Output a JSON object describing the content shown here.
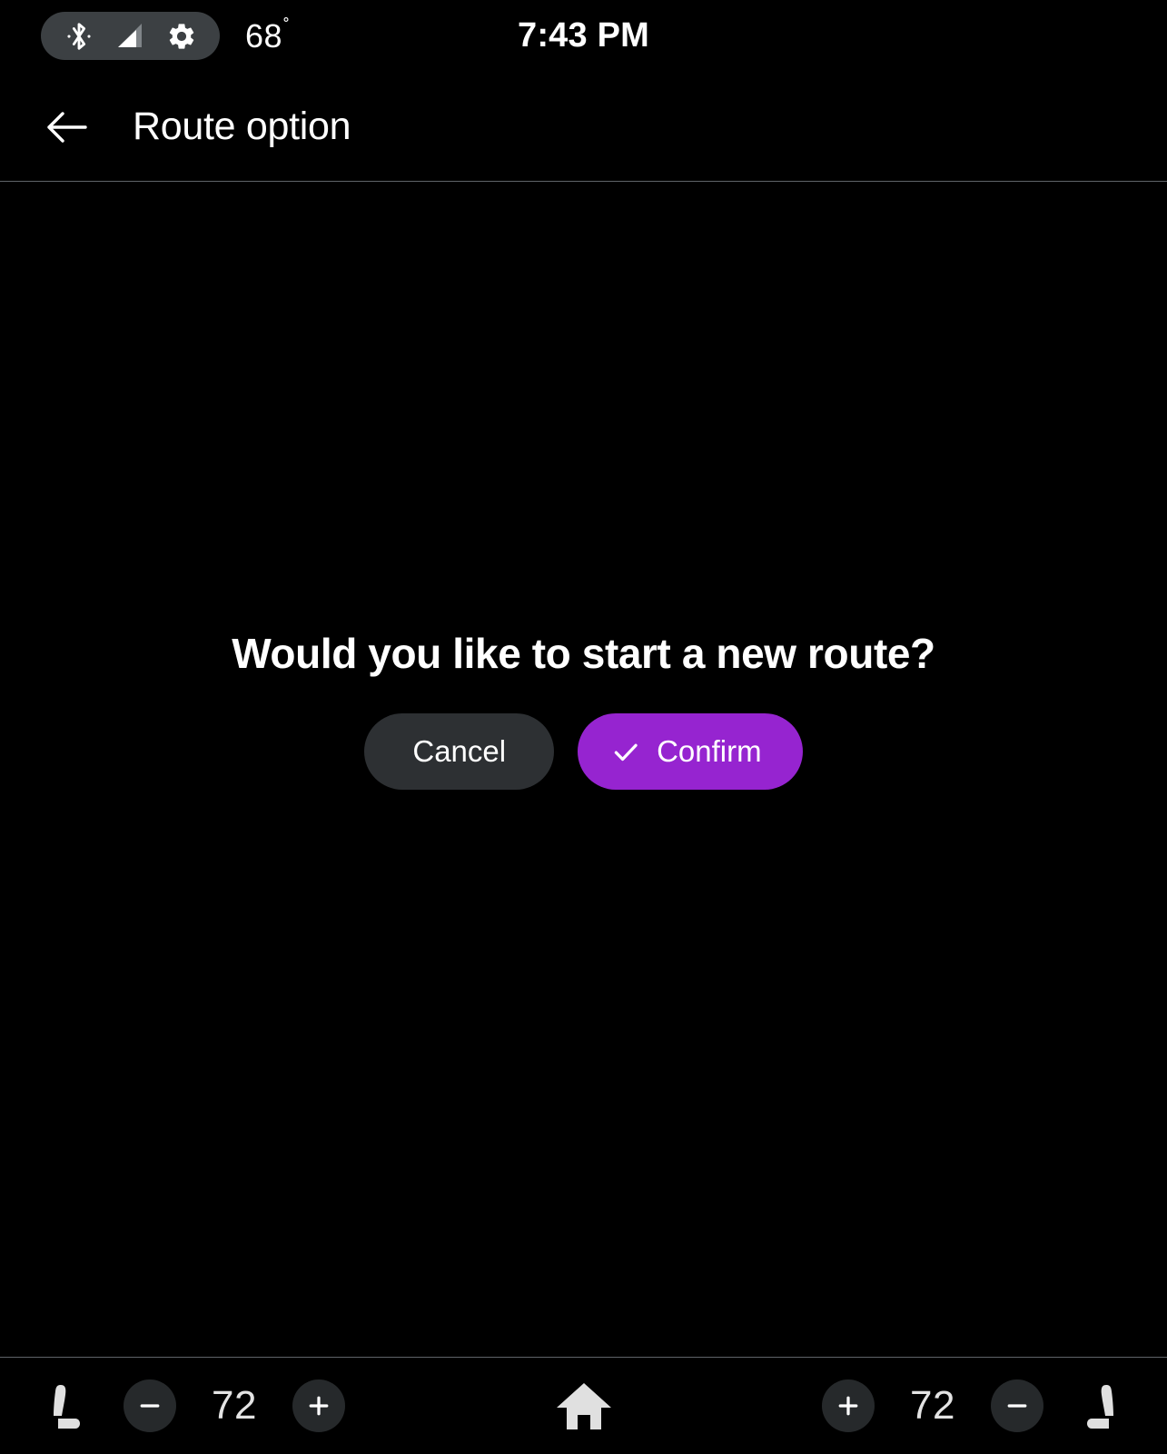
{
  "status_bar": {
    "icons": [
      {
        "name": "bluetooth-icon",
        "label": "Bluetooth"
      },
      {
        "name": "signal-icon",
        "label": "Cellular signal"
      },
      {
        "name": "gear-icon",
        "label": "Settings"
      }
    ],
    "outside_temperature": "68",
    "degree_symbol": "˚",
    "clock": "7:43 PM",
    "pill_background": "#3c4043"
  },
  "app_bar": {
    "back_icon": "arrow-left-icon",
    "title": "Route option"
  },
  "dialog": {
    "message": "Would you like to start a new route?",
    "cancel_label": "Cancel",
    "confirm_label": "Confirm",
    "confirm_icon": "check-icon",
    "confirm_color": "#9624d0",
    "cancel_color": "#2d3033"
  },
  "bottom_bar": {
    "left_climate": {
      "seat_icon": "seat-icon",
      "decrease_label": "−",
      "temperature": "72",
      "increase_label": "+"
    },
    "home_icon": "home-icon",
    "right_climate": {
      "increase_label": "+",
      "temperature": "72",
      "decrease_label": "−",
      "seat_icon": "seat-icon"
    },
    "button_color": "#26292b",
    "divider_color": "#5f6368"
  }
}
